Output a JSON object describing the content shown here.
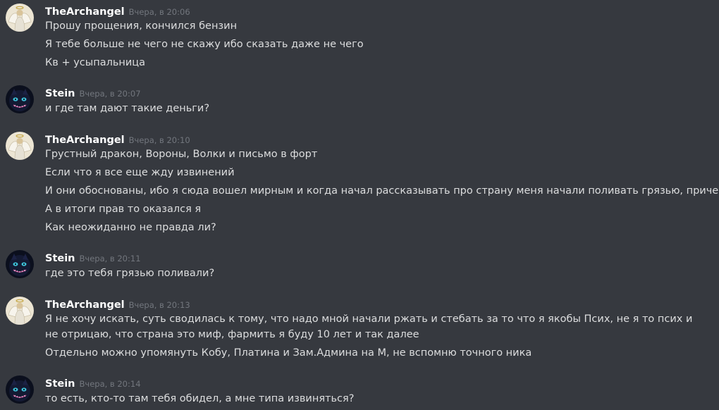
{
  "colors": {
    "background": "#36393f",
    "username": "#ffffff",
    "message_text": "#dcddde",
    "timestamp": "#72767d"
  },
  "messages": [
    {
      "author": "TheArchangel",
      "avatar_icon": "angel-avatar-icon",
      "timestamp": "Вчера, в 20:06",
      "lines": [
        "Прошу прощения, кончился бензин",
        "Я тебе больше не чего не скажу ибо сказать даже не чего",
        "Кв + усыпальница"
      ]
    },
    {
      "author": "Stein",
      "avatar_icon": "dark-cat-avatar-icon",
      "timestamp": "Вчера, в 20:07",
      "lines": [
        "и где там дают такие деньги?"
      ]
    },
    {
      "author": "TheArchangel",
      "avatar_icon": "angel-avatar-icon",
      "timestamp": "Вчера, в 20:10",
      "lines": [
        "Грустный дракон, Вороны, Волки и письмо в форт",
        "Если что я все еще жду извинений",
        "И они обоснованы, ибо я сюда вошел мирным и когда начал рассказывать про страну меня начали поливать грязью, причем конкретно",
        "А в итоги прав то оказался я",
        "Как неожиданно не правда ли?"
      ]
    },
    {
      "author": "Stein",
      "avatar_icon": "dark-cat-avatar-icon",
      "timestamp": "Вчера, в 20:11",
      "lines": [
        "где это тебя грязью поливали?"
      ]
    },
    {
      "author": "TheArchangel",
      "avatar_icon": "angel-avatar-icon",
      "timestamp": "Вчера, в 20:13",
      "lines": [
        "Я не хочу искать, суть сводилась к тому, что надо мной начали ржать и стебать за то что я якобы Псих, не я то псих и не отрицаю, что страна это миф, фармить я буду 10 лет и так далее",
        "Отдельно можно упомянуть Кобу, Платина и Зам.Админа на М, не вспомню точного ника"
      ]
    },
    {
      "author": "Stein",
      "avatar_icon": "dark-cat-avatar-icon",
      "timestamp": "Вчера, в 20:14",
      "lines": [
        "то есть, кто-то там тебя обидел, а мне типа извиняться?"
      ]
    }
  ]
}
